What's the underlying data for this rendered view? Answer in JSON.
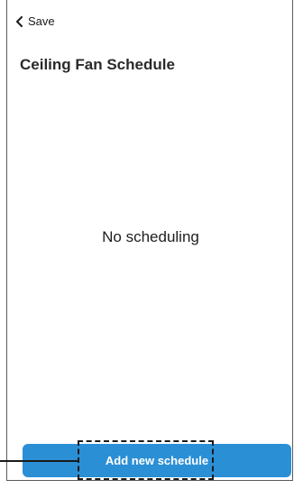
{
  "header": {
    "back_label": "Save",
    "back_icon": "chevron-left-icon"
  },
  "main": {
    "title": "Ceiling Fan Schedule",
    "empty_state": "No scheduling"
  },
  "footer": {
    "add_button_label": "Add new schedule"
  },
  "colors": {
    "accent": "#2b8fd6",
    "text": "#222222",
    "annotation": "#1a1a1a"
  }
}
